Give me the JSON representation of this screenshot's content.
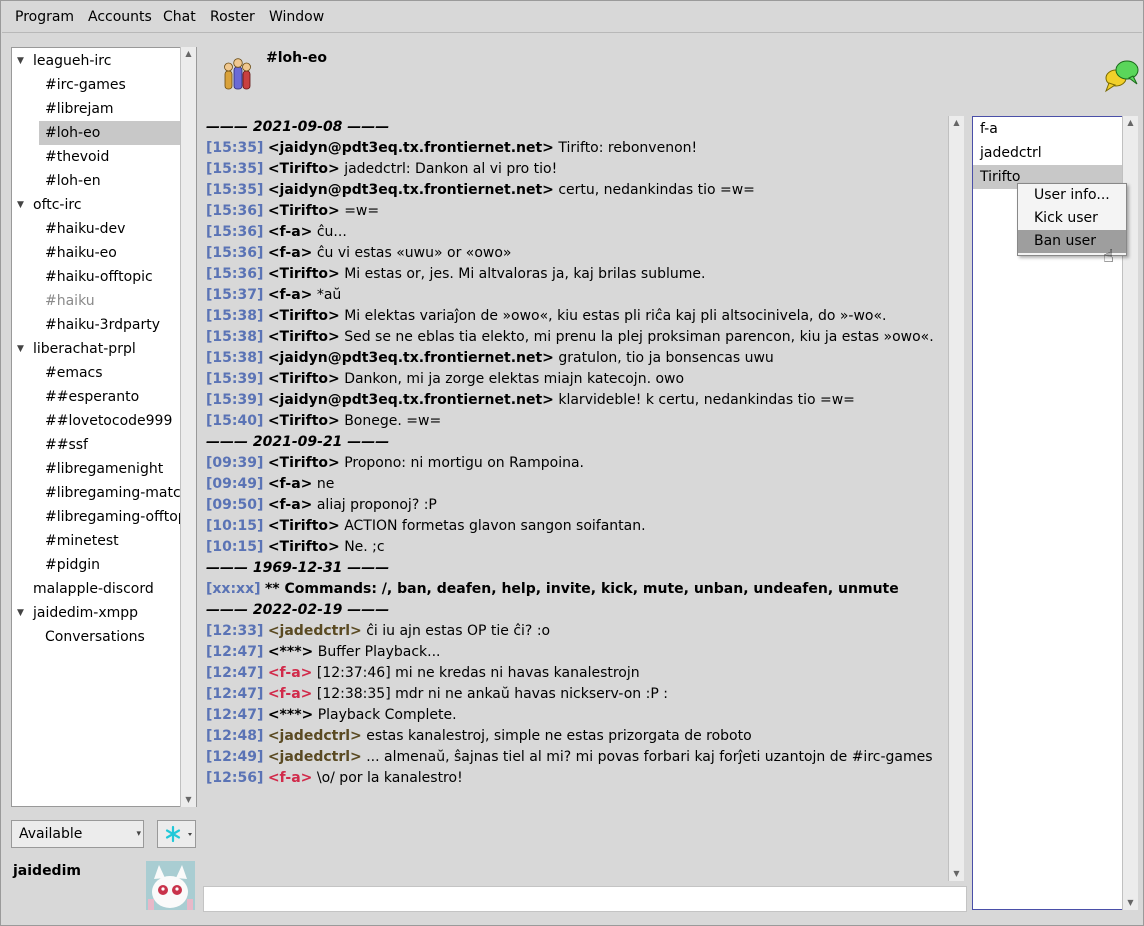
{
  "menu": [
    "Program",
    "Accounts",
    "Chat",
    "Roster",
    "Window"
  ],
  "tree": [
    {
      "label": "leagueh-irc",
      "level": 0,
      "expanded": true
    },
    {
      "label": "#irc-games",
      "level": 1
    },
    {
      "label": "#librejam",
      "level": 1
    },
    {
      "label": "#loh-eo",
      "level": 1,
      "selected": true
    },
    {
      "label": "#thevoid",
      "level": 1
    },
    {
      "label": "#loh-en",
      "level": 1
    },
    {
      "label": "oftc-irc",
      "level": 0,
      "expanded": true
    },
    {
      "label": "#haiku-dev",
      "level": 1
    },
    {
      "label": "#haiku-eo",
      "level": 1
    },
    {
      "label": "#haiku-offtopic",
      "level": 1
    },
    {
      "label": "#haiku",
      "level": 1,
      "dim": true
    },
    {
      "label": "#haiku-3rdparty",
      "level": 1
    },
    {
      "label": "liberachat-prpl",
      "level": 0,
      "expanded": true
    },
    {
      "label": "#emacs",
      "level": 1
    },
    {
      "label": "##esperanto",
      "level": 1
    },
    {
      "label": "##lovetocode999",
      "level": 1
    },
    {
      "label": "##ssf",
      "level": 1
    },
    {
      "label": "#libregamenight",
      "level": 1
    },
    {
      "label": "#libregaming-matchm",
      "level": 1
    },
    {
      "label": "#libregaming-offtopic",
      "level": 1
    },
    {
      "label": "#minetest",
      "level": 1
    },
    {
      "label": "#pidgin",
      "level": 1
    },
    {
      "label": "malapple-discord",
      "level": 0
    },
    {
      "label": "jaidedim-xmpp",
      "level": 0,
      "expanded": true
    },
    {
      "label": "Conversations",
      "level": 1
    }
  ],
  "status": {
    "value": "Available"
  },
  "account": {
    "name": "jaidedim"
  },
  "channel": {
    "title": "#loh-eo"
  },
  "log": [
    {
      "type": "date",
      "text": "——— 2021-09-08 ———"
    },
    {
      "ts": "[15:35]",
      "nick": "<jaidyn@pdt3eq.tx.frontiernet.net>",
      "style": "plain",
      "msg": " Tirifto: rebonvenon!"
    },
    {
      "ts": "[15:35]",
      "nick": "<Tirifto>",
      "style": "plain",
      "msg": " jadedctrl: Dankon al vi pro tio!"
    },
    {
      "ts": "[15:35]",
      "nick": "<jaidyn@pdt3eq.tx.frontiernet.net>",
      "style": "plain",
      "msg": " certu, nedankindas tio =w="
    },
    {
      "ts": "[15:36]",
      "nick": "<Tirifto>",
      "style": "plain",
      "msg": " =w="
    },
    {
      "ts": "[15:36]",
      "nick": "<f-a>",
      "style": "plain",
      "msg": " ĉu..."
    },
    {
      "ts": "[15:36]",
      "nick": "<f-a>",
      "style": "plain",
      "msg": " ĉu vi estas «uwu» or «owo»"
    },
    {
      "ts": "[15:36]",
      "nick": "<Tirifto>",
      "style": "plain",
      "msg": " Mi estas or, jes. Mi altvaloras ja, kaj brilas sublume."
    },
    {
      "ts": "[15:37]",
      "nick": "<f-a>",
      "style": "plain",
      "msg": " *aŭ"
    },
    {
      "ts": "[15:38]",
      "nick": "<Tirifto>",
      "style": "plain",
      "msg": " Mi elektas variaĵon de »owo«, kiu estas pli riĉa kaj pli altsocinivela, do »-wo«."
    },
    {
      "ts": "[15:38]",
      "nick": "<Tirifto>",
      "style": "plain",
      "msg": " Sed se ne eblas tia elekto, mi prenu la plej proksiman parencon, kiu ja estas »owo«."
    },
    {
      "ts": "[15:38]",
      "nick": "<jaidyn@pdt3eq.tx.frontiernet.net>",
      "style": "plain",
      "msg": " gratulon, tio ja bonsencas uwu"
    },
    {
      "ts": "[15:39]",
      "nick": "<Tirifto>",
      "style": "plain",
      "msg": " Dankon, mi ja zorge elektas miajn katecojn. owo"
    },
    {
      "ts": "[15:39]",
      "nick": "<jaidyn@pdt3eq.tx.frontiernet.net>",
      "style": "plain",
      "msg": " klarvideble! k certu, nedankindas tio =w="
    },
    {
      "ts": "[15:40]",
      "nick": "<Tirifto>",
      "style": "plain",
      "msg": " Bonege. =w="
    },
    {
      "type": "date",
      "text": "——— 2021-09-21 ———"
    },
    {
      "ts": "[09:39]",
      "nick": "<Tirifto>",
      "style": "plain",
      "msg": " Propono: ni mortigu on Rampoina."
    },
    {
      "ts": "[09:49]",
      "nick": "<f-a>",
      "style": "plain",
      "msg": " ne"
    },
    {
      "ts": "[09:50]",
      "nick": "<f-a>",
      "style": "plain",
      "msg": " aliaj proponoj? :P"
    },
    {
      "ts": "[10:15]",
      "nick": "<Tirifto>",
      "style": "plain",
      "msg": "  ACTION formetas glavon sangon soifantan."
    },
    {
      "ts": "[10:15]",
      "nick": "<Tirifto>",
      "style": "plain",
      "msg": " Ne. ;c"
    },
    {
      "type": "date",
      "text": "——— 1969-12-31 ———"
    },
    {
      "ts": "[xx:xx]",
      "nick": "",
      "style": "plain",
      "msg": " ** Commands: /, ban, deafen, help, invite, kick, mute, unban, undeafen, unmute",
      "boldmsg": true
    },
    {
      "type": "date",
      "text": "——— 2022-02-19 ———"
    },
    {
      "ts": "[12:33]",
      "nick": "<jadedctrl>",
      "style": "j",
      "msg": " ĉi iu ajn estas OP tie ĉi? :o"
    },
    {
      "ts": "[12:47]",
      "nick": "<***>",
      "style": "plain",
      "msg": " Buffer Playback..."
    },
    {
      "ts": "[12:47]",
      "nick": "<f-a>",
      "style": "f",
      "msg": " [12:37:46] mi ne kredas ni havas kanalestrojn"
    },
    {
      "ts": "[12:47]",
      "nick": "<f-a>",
      "style": "f",
      "msg": " [12:38:35] mdr ni ne ankaŭ havas nickserv-on :P :"
    },
    {
      "ts": "[12:47]",
      "nick": "<***>",
      "style": "plain",
      "msg": " Playback Complete."
    },
    {
      "ts": "[12:48]",
      "nick": "<jadedctrl>",
      "style": "j",
      "msg": " estas kanalestroj, simple ne estas prizorgata de roboto"
    },
    {
      "ts": "[12:49]",
      "nick": "<jadedctrl>",
      "style": "j",
      "msg": " ... almenaŭ, ŝajnas tiel al mi? mi povas forbari kaj forĵeti uzantojn de #irc-games"
    },
    {
      "ts": "[12:56]",
      "nick": "<f-a>",
      "style": "f",
      "msg": " \\o/ por la kanalestro!"
    }
  ],
  "users": [
    {
      "name": "f-a"
    },
    {
      "name": "jadedctrl"
    },
    {
      "name": "Tirifto",
      "selected": true
    }
  ],
  "context_menu": [
    {
      "label": "User info..."
    },
    {
      "label": "Kick user"
    },
    {
      "label": "Ban user",
      "highlighted": true
    }
  ],
  "colors": {
    "timestamp": "#5a73b5",
    "nick_jadedctrl": "#5a4a22",
    "nick_fa": "#d12a4a",
    "selection": "#c8c8c8",
    "userlist_border": "#4a4fa8"
  }
}
